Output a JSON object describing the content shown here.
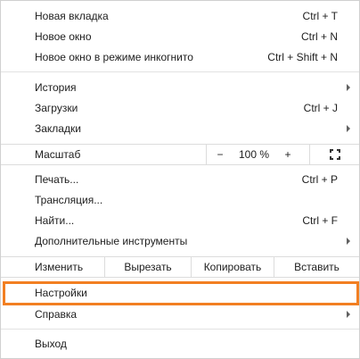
{
  "menu": {
    "group1": [
      {
        "label": "Новая вкладка",
        "shortcut": "Ctrl + T"
      },
      {
        "label": "Новое окно",
        "shortcut": "Ctrl + N"
      },
      {
        "label": "Новое окно в режиме инкогнито",
        "shortcut": "Ctrl + Shift + N"
      }
    ],
    "group2": [
      {
        "label": "История",
        "shortcut": "",
        "submenu": true
      },
      {
        "label": "Загрузки",
        "shortcut": "Ctrl + J",
        "submenu": false
      },
      {
        "label": "Закладки",
        "shortcut": "",
        "submenu": true
      }
    ],
    "zoom": {
      "label": "Масштаб",
      "minus": "−",
      "value": "100 %",
      "plus": "+",
      "fullscreen_icon": "fullscreen-icon"
    },
    "group3": [
      {
        "label": "Печать...",
        "shortcut": "Ctrl + P",
        "submenu": false
      },
      {
        "label": "Трансляция...",
        "shortcut": "",
        "submenu": false
      },
      {
        "label": "Найти...",
        "shortcut": "Ctrl + F",
        "submenu": false
      },
      {
        "label": "Дополнительные инструменты",
        "shortcut": "",
        "submenu": true
      }
    ],
    "edit": {
      "label": "Изменить",
      "cut": "Вырезать",
      "copy": "Копировать",
      "paste": "Вставить"
    },
    "settings": {
      "label": "Настройки"
    },
    "help": {
      "label": "Справка",
      "submenu": true
    },
    "exit": {
      "label": "Выход"
    },
    "highlight_color": "#f27f22"
  }
}
